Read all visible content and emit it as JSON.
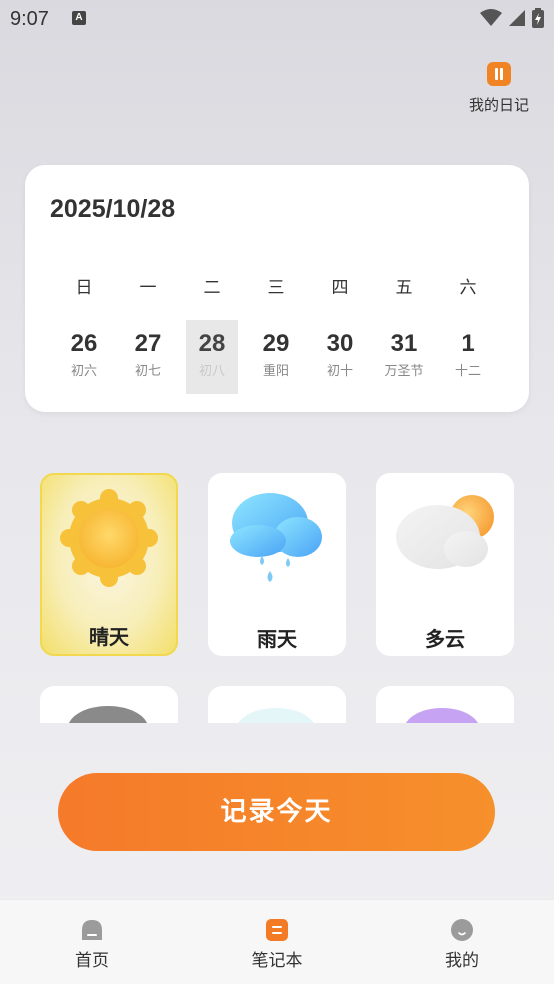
{
  "status_bar": {
    "time": "9:07",
    "badge": "A"
  },
  "diary_button": {
    "label": "我的日记",
    "icon": "pause-diary-icon",
    "color": "#f08424"
  },
  "calendar": {
    "date": "2025/10/28",
    "weekdays": [
      "日",
      "一",
      "二",
      "三",
      "四",
      "五",
      "六"
    ],
    "days": [
      {
        "day": "26",
        "lunar": "初六"
      },
      {
        "day": "27",
        "lunar": "初七"
      },
      {
        "day": "28",
        "lunar": "初八",
        "selected": true
      },
      {
        "day": "29",
        "lunar": "重阳"
      },
      {
        "day": "30",
        "lunar": "初十"
      },
      {
        "day": "31",
        "lunar": "万圣节"
      },
      {
        "day": "1",
        "lunar": "十二"
      }
    ]
  },
  "weather": {
    "options": [
      {
        "label": "晴天",
        "icon": "sun-icon",
        "selected": true
      },
      {
        "label": "雨天",
        "icon": "rain-cloud-icon"
      },
      {
        "label": "多云",
        "icon": "cloudy-icon"
      }
    ],
    "partial_row_icons": [
      "dark-cloud-icon",
      "wind-icon",
      "purple-weather-icon"
    ]
  },
  "record_button": {
    "label": "记录今天",
    "colors": [
      "#f57a2a",
      "#f6902b"
    ]
  },
  "bottom_nav": {
    "items": [
      {
        "label": "首页",
        "icon": "home-icon"
      },
      {
        "label": "笔记本",
        "icon": "notebook-icon",
        "active": true
      },
      {
        "label": "我的",
        "icon": "profile-icon"
      }
    ]
  }
}
